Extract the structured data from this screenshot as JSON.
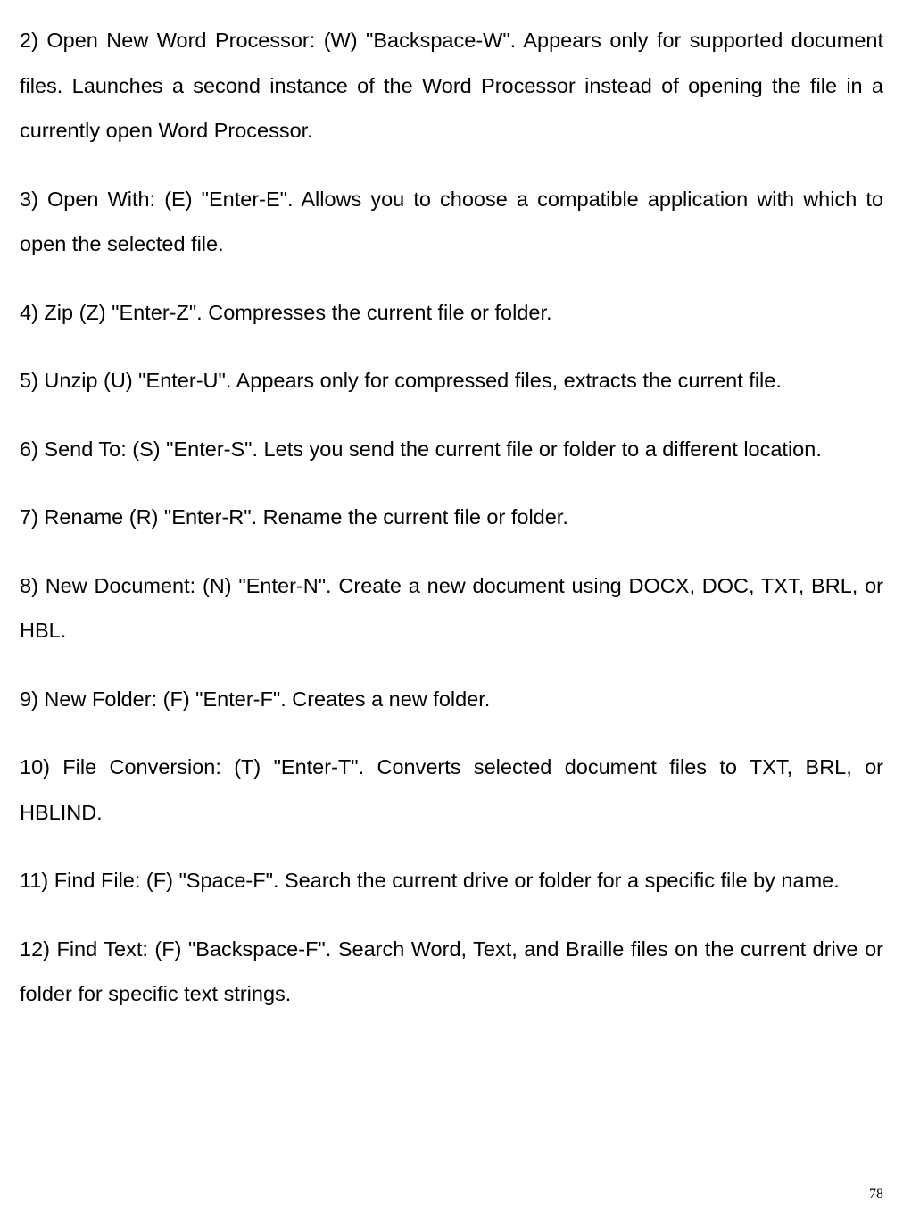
{
  "paragraphs": {
    "p1": "2) Open New Word Processor: (W) \"Backspace-W\". Appears only for supported document files. Launches a second instance of the Word Processor instead of opening the file in a currently open Word Processor.",
    "p2": "3) Open With: (E) \"Enter-E\". Allows you to choose a compatible application with which to open the selected file.",
    "p3": "4) Zip (Z) \"Enter-Z\". Compresses the current file or folder.",
    "p4": "5) Unzip (U) \"Enter-U\". Appears only for compressed files, extracts the current file.",
    "p5": "6) Send To: (S) \"Enter-S\". Lets you send the current file or folder to a different location.",
    "p6": "7) Rename (R) \"Enter-R\". Rename the current file or folder.",
    "p7": "8) New Document: (N) \"Enter-N\". Create a new document using DOCX, DOC, TXT, BRL, or HBL.",
    "p8": "9) New Folder: (F) \"Enter-F\". Creates a new folder.",
    "p9": "10) File Conversion: (T) \"Enter-T\". Converts selected document files to TXT, BRL, or HBLIND.",
    "p10": "11) Find File: (F) \"Space-F\". Search the current drive or folder for a specific file by name.",
    "p11": "12) Find Text: (F) \"Backspace-F\". Search Word, Text, and Braille files on the current drive or folder for specific text strings."
  },
  "page_number": "78"
}
